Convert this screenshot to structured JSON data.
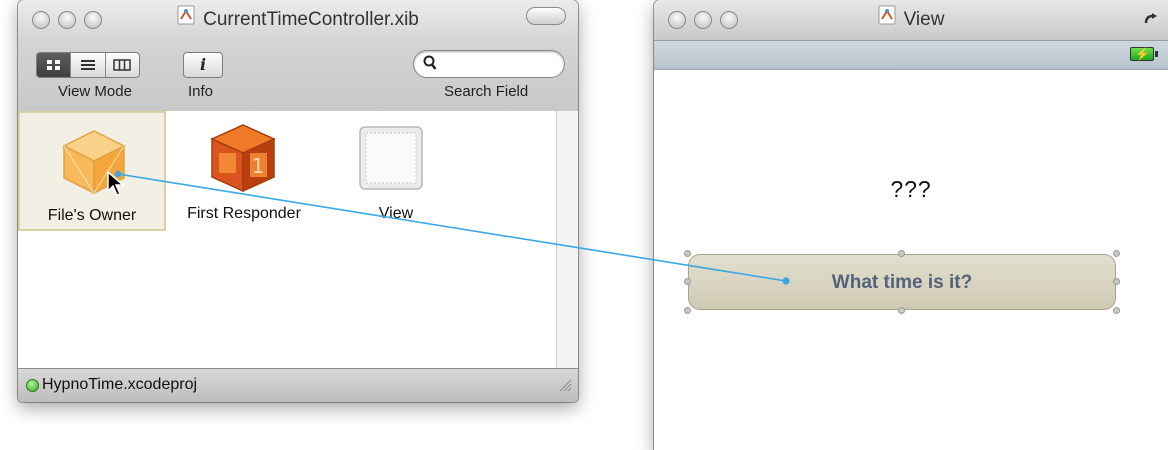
{
  "doc_window": {
    "title": "CurrentTimeController.xib",
    "toolbar": {
      "view_mode_label": "View Mode",
      "info_label": "Info",
      "info_glyph": "i",
      "search_label": "Search Field",
      "search_placeholder": ""
    },
    "objects": [
      {
        "label": "File's Owner",
        "icon": "cube-icon",
        "selected": true
      },
      {
        "label": "First Responder",
        "icon": "first-responder-icon",
        "selected": false
      },
      {
        "label": "View",
        "icon": "view-icon",
        "selected": false
      }
    ],
    "status": {
      "project": "HypnoTime.xcodeproj"
    }
  },
  "view_window": {
    "title": "View",
    "label_text": "???",
    "button_label": "What time is it?"
  },
  "colors": {
    "connection_line": "#3aa7e6",
    "button_fill": "#d8d4c0",
    "button_text": "#55627a"
  }
}
